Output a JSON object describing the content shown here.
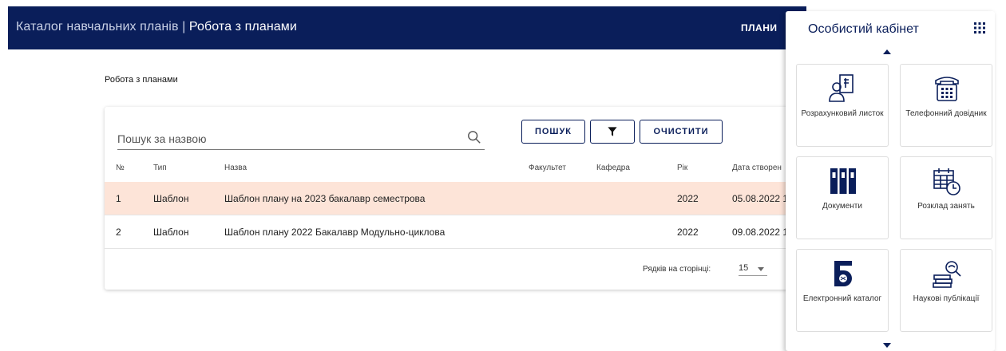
{
  "header": {
    "app_title": "Каталог навчальних планів",
    "separator": " | ",
    "section_title": "Робота з планами",
    "nav_label": "ПЛАНИ"
  },
  "breadcrumb": "Робота з планами",
  "search": {
    "placeholder": "Пошук за назвою"
  },
  "buttons": {
    "search": "ПОШУК",
    "clear": "ОЧИСТИТИ"
  },
  "table": {
    "columns": [
      "№",
      "Тип",
      "Назва",
      "Факультет",
      "Кафедра",
      "Рік",
      "Дата створен"
    ],
    "rows": [
      {
        "num": "1",
        "type": "Шаблон",
        "name": "Шаблон плану на 2023 бакалавр семестрова",
        "faculty": "",
        "department": "",
        "year": "2022",
        "date": "05.08.2022 1"
      },
      {
        "num": "2",
        "type": "Шаблон",
        "name": "Шаблон плану 2022 Бакалавр Модульно-циклова",
        "faculty": "",
        "department": "",
        "year": "2022",
        "date": "09.08.2022 1"
      }
    ],
    "rows_per_page_label": "Рядків на сторінці:",
    "rows_per_page_value": "15"
  },
  "cabinet": {
    "title": "Особистий кабінет",
    "tiles": [
      {
        "label": "Розрахунковий листок",
        "icon": "payslip-icon"
      },
      {
        "label": "Телефонний довідник",
        "icon": "phone-icon"
      },
      {
        "label": "Документи",
        "icon": "documents-icon"
      },
      {
        "label": "Розклад занять",
        "icon": "schedule-icon"
      },
      {
        "label": "Електронний каталог",
        "icon": "catalog-icon"
      },
      {
        "label": "Наукові публікації",
        "icon": "publications-icon"
      }
    ]
  },
  "colors": {
    "brand": "#0a1e5a",
    "selected_row": "#fde4d8"
  }
}
